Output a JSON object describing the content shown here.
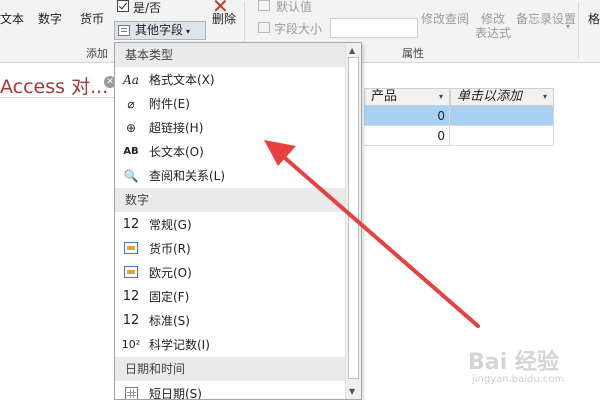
{
  "ribbon": {
    "btn_text_partial": "文本",
    "btn_number": "数字",
    "btn_currency": "货币",
    "yes_no": "是/否",
    "other_fields": "其他字段",
    "delete": "删除",
    "default_value": "默认值",
    "field_size": "字段大小",
    "modify_lookup": "修改查阅",
    "modify_expression": "修改",
    "modify_expression_2": "表达式",
    "memo_settings": "备忘录设置",
    "group_add_partial": "添加",
    "group_properties": "属性",
    "format_partial": "格"
  },
  "document": {
    "title": "Access 对..."
  },
  "grid": {
    "columns": [
      "产品",
      "单击以添加"
    ],
    "rows": [
      [
        "0",
        ""
      ],
      [
        "0",
        ""
      ]
    ],
    "selected_color": "#a9d1f3"
  },
  "dropdown": {
    "sections": [
      {
        "header": "基本类型",
        "items": [
          {
            "icon": "Aa",
            "label": "格式文本(X)"
          },
          {
            "icon": "⌀",
            "label": "附件(E)"
          },
          {
            "icon": "⊕",
            "label": "超链接(H)"
          },
          {
            "icon": "AB",
            "label": "长文本(O)"
          },
          {
            "icon": "🔍",
            "label": "查阅和关系(L)"
          }
        ]
      },
      {
        "header": "数字",
        "items": [
          {
            "icon": "12",
            "label": "常规(G)"
          },
          {
            "icon": "",
            "label": "货币(R)"
          },
          {
            "icon": "",
            "label": "欧元(O)"
          },
          {
            "icon": "12",
            "label": "固定(F)"
          },
          {
            "icon": "12",
            "label": "标准(S)"
          },
          {
            "icon": "10²",
            "label": "科学记数(I)"
          }
        ]
      },
      {
        "header": "日期和时间",
        "items": [
          {
            "icon": "",
            "label": "短日期(S)"
          }
        ]
      }
    ]
  },
  "annotation": {
    "arrow_color": "#e84040"
  },
  "watermark": {
    "text": "Bai 经验",
    "url": "jingyan.baidu.com"
  }
}
